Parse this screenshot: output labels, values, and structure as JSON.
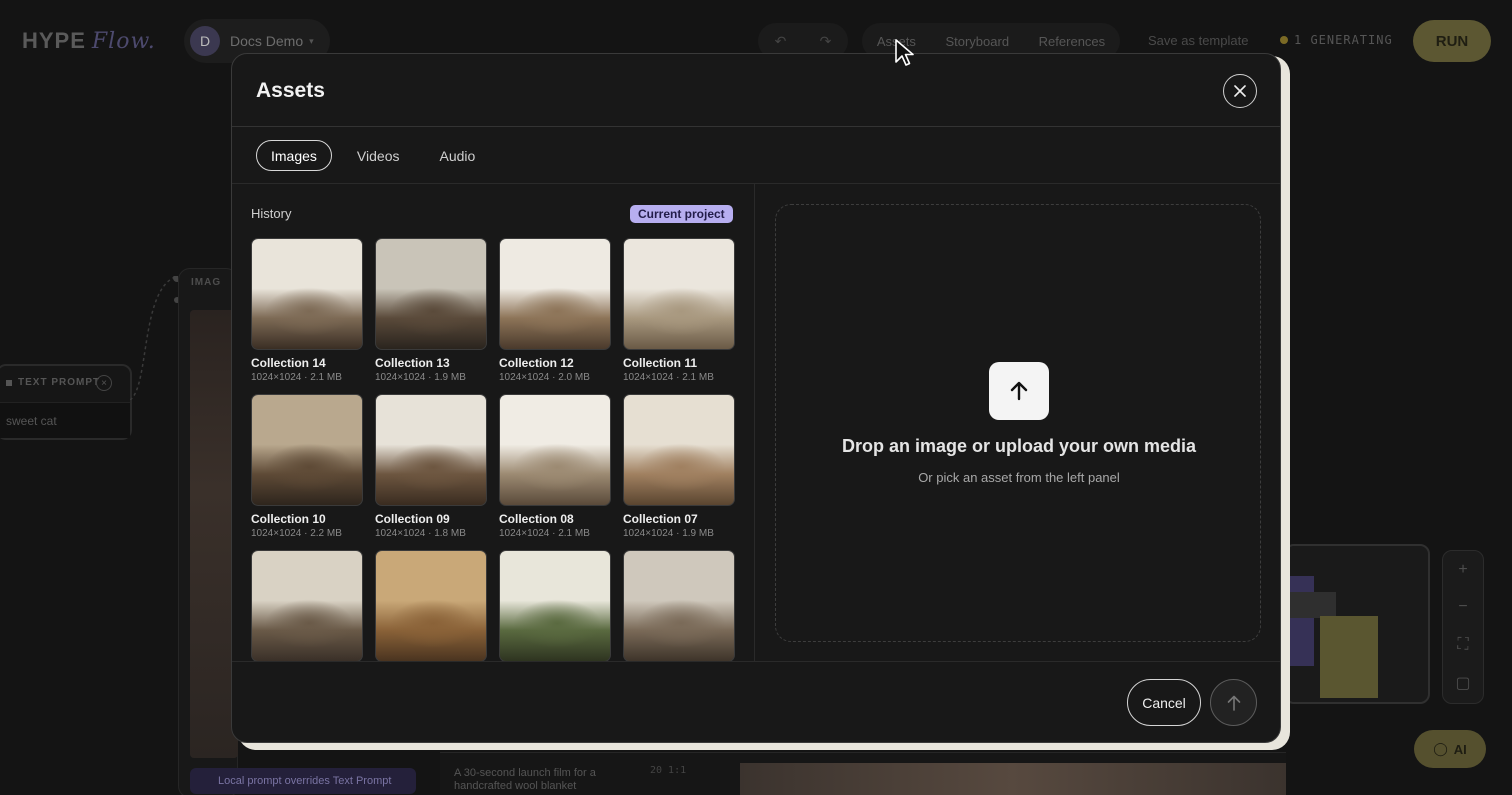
{
  "app": {
    "logo_main": "HYPE",
    "logo_sub": "Flow.",
    "project_initial": "D",
    "project_name": "Docs Demo",
    "nav_tabs": [
      "Assets",
      "Storyboard",
      "References"
    ],
    "save_template": "Save as template",
    "generating": "1 GENERATING",
    "run_label": "RUN",
    "ai_label": "AI"
  },
  "canvas": {
    "text_prompt_title": "TEXT PROMPT",
    "text_prompt_value": "sweet cat",
    "image_node_title": "IMAG",
    "local_prompt_note": "Local prompt overrides Text Prompt",
    "clip_description": "A 30-second launch film for a handcrafted wool blanket",
    "clip_meta": "20    1:1"
  },
  "modal": {
    "title": "Assets",
    "tabs": [
      {
        "label": "Images",
        "active": true
      },
      {
        "label": "Videos",
        "active": false
      },
      {
        "label": "Audio",
        "active": false
      }
    ],
    "history_label": "History",
    "current_project_badge": "Current project",
    "assets": [
      {
        "name": "Collection 14",
        "meta": "1024×1024 · 2.1 MB",
        "palette": [
          "#e9e4da",
          "#7d6a55",
          "#3a2e24"
        ]
      },
      {
        "name": "Collection 13",
        "meta": "1024×1024 · 1.9 MB",
        "palette": [
          "#c9c4b8",
          "#5a4a3a",
          "#2a241e"
        ]
      },
      {
        "name": "Collection 12",
        "meta": "1024×1024 · 2.0 MB",
        "palette": [
          "#eeeae2",
          "#8d7458",
          "#4a3a2c"
        ]
      },
      {
        "name": "Collection 11",
        "meta": "1024×1024 · 2.1 MB",
        "palette": [
          "#ebe6dd",
          "#a8987f",
          "#6a5a46"
        ]
      },
      {
        "name": "Collection 10",
        "meta": "1024×1024 · 2.2 MB",
        "palette": [
          "#b9a88e",
          "#5e4a36",
          "#2e251d"
        ]
      },
      {
        "name": "Collection 09",
        "meta": "1024×1024 · 1.8 MB",
        "palette": [
          "#e7e2d8",
          "#6d5640",
          "#3a2c20"
        ]
      },
      {
        "name": "Collection 08",
        "meta": "1024×1024 · 2.1 MB",
        "palette": [
          "#f0ece4",
          "#9c8a72",
          "#5a4a3a"
        ]
      },
      {
        "name": "Collection 07",
        "meta": "1024×1024 · 1.9 MB",
        "palette": [
          "#e6dfd2",
          "#a08060",
          "#5a4530"
        ]
      },
      {
        "name": "",
        "meta": "",
        "palette": [
          "#d9d2c4",
          "#6a5a48",
          "#3a3028"
        ]
      },
      {
        "name": "",
        "meta": "",
        "palette": [
          "#c9a878",
          "#8a6238",
          "#4a3420"
        ]
      },
      {
        "name": "",
        "meta": "",
        "palette": [
          "#e8e6da",
          "#5a6a40",
          "#2e3420"
        ]
      },
      {
        "name": "",
        "meta": "",
        "palette": [
          "#cfc8bc",
          "#7a6a58",
          "#3e342a"
        ]
      }
    ],
    "drop_title": "Drop an image or upload your own media",
    "drop_subtitle": "Or pick an asset from the left panel",
    "cancel_label": "Cancel"
  }
}
